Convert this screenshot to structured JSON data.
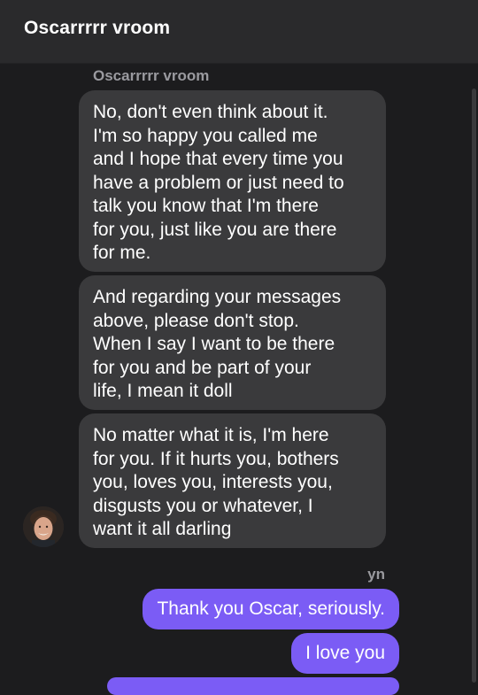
{
  "header": {
    "title": "Oscarrrrr vroom"
  },
  "thread": {
    "incoming_sender": "Oscarrrrr vroom",
    "incoming": [
      {
        "text": "No, don't even think about it.\nI'm so happy you called me\nand I hope that every time you\nhave a problem or just need to\ntalk you know that I'm there\nfor you, just like you are there\nfor me."
      },
      {
        "text": "And regarding your messages\nabove, please don't stop.\nWhen I say I want to be there\nfor you and be part of your\nlife, I mean it doll"
      },
      {
        "text": "No matter what it is, I'm here\nfor you. If it hurts you, bothers\nyou, loves you, interests you,\ndisgusts you or whatever, I\nwant it all darling"
      }
    ],
    "outgoing_sender": "yn",
    "outgoing": [
      {
        "text": "Thank you Oscar, seriously."
      },
      {
        "text": "I love you"
      }
    ]
  },
  "colors": {
    "background": "#1c1c1e",
    "header": "#2a2a2c",
    "incoming_bubble": "#3a3a3c",
    "outgoing_bubble": "#7b5cf5"
  }
}
